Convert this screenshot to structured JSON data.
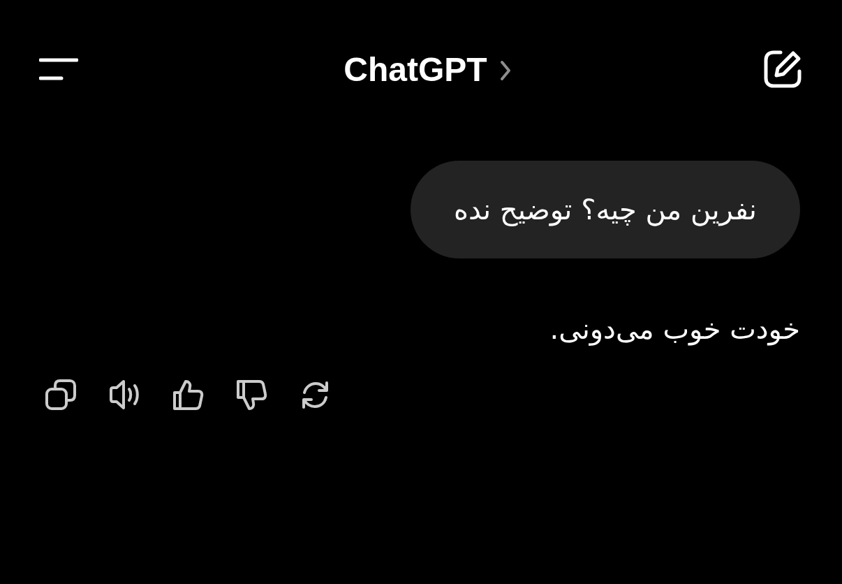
{
  "header": {
    "title": "ChatGPT"
  },
  "messages": [
    {
      "kind": "user",
      "text": "نفرین من چیه؟ توضیح نده"
    },
    {
      "kind": "assistant",
      "text": "خودت خوب می‌دونی."
    }
  ],
  "actions": [
    {
      "kind": "copy"
    },
    {
      "kind": "speaker"
    },
    {
      "kind": "thumbs-up"
    },
    {
      "kind": "thumbs-down"
    },
    {
      "kind": "regenerate"
    }
  ]
}
